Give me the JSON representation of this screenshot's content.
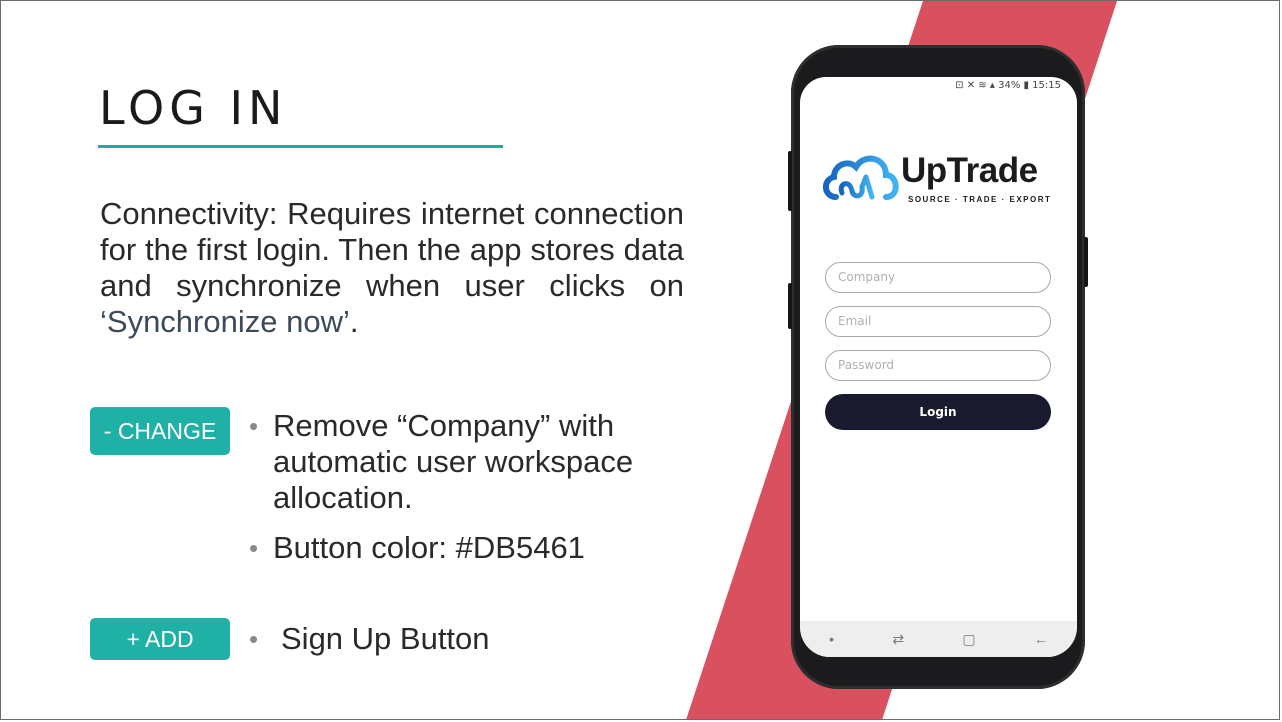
{
  "slide": {
    "title": "LOG IN",
    "description_main": "Connectivity: Requires internet connection for the first login. Then the app stores data and synchronize when user clicks on ",
    "description_highlight": "‘Synchronize now’",
    "description_end": ".",
    "change_tag": "- CHANGE",
    "add_tag": "+ ADD",
    "bullets": [
      "Remove “Company” with automatic user workspace allocation.",
      "Button color: #DB5461",
      "Sign Up Button"
    ],
    "bullet_char": "•"
  },
  "colors": {
    "accent_teal": "#1fb0a6",
    "stripe_red": "#DB5461",
    "login_button": "#1a1a2e"
  },
  "phone": {
    "status_bar": "34% ▮ 15:15",
    "status_icons": [
      "nfc-icon",
      "mute-icon",
      "wifi-icon",
      "signal-icon",
      "battery-icon"
    ],
    "brand_name": "UpTrade",
    "brand_tagline": "SOURCE · TRADE · EXPORT",
    "company_placeholder": "Company",
    "email_placeholder": "Email",
    "password_placeholder": "Password",
    "login_label": "Login",
    "nav": {
      "dot": "•",
      "recent": "⇄",
      "home": "▢",
      "back": "←"
    }
  }
}
